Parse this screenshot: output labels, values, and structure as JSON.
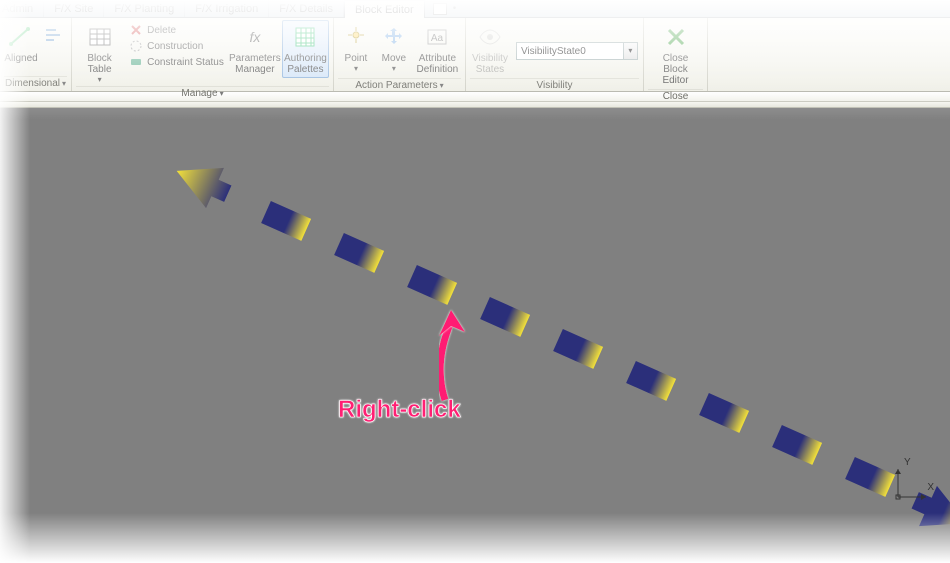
{
  "tabs": {
    "partial": "Admin",
    "items": [
      "F/X Site",
      "F/X Planting",
      "F/X Irrigation",
      "F/X Details",
      "Block Editor"
    ],
    "active_index": 4
  },
  "ribbon": {
    "panels": {
      "dimensional": {
        "title": "Dimensional",
        "aligned": "Aligned"
      },
      "manage": {
        "title": "Manage",
        "block_table": "Block\nTable",
        "delete": "Delete",
        "construction": "Construction",
        "constraint_status": "Constraint Status",
        "parameters_manager": "Parameters\nManager",
        "authoring_palettes": "Authoring\nPalettes"
      },
      "action_parameters": {
        "title": "Action Parameters",
        "point": "Point",
        "move": "Move",
        "attribute_definition": "Attribute\nDefinition"
      },
      "visibility": {
        "title": "Visibility",
        "states": "Visibility\nStates",
        "combo_value": "VisibilityState0"
      },
      "close": {
        "title": "Close",
        "close_block_editor": "Close\nBlock Editor"
      }
    }
  },
  "canvas": {
    "ucs": {
      "x_label": "X",
      "y_label": "Y"
    }
  },
  "annotation": {
    "label": "Right-click"
  }
}
